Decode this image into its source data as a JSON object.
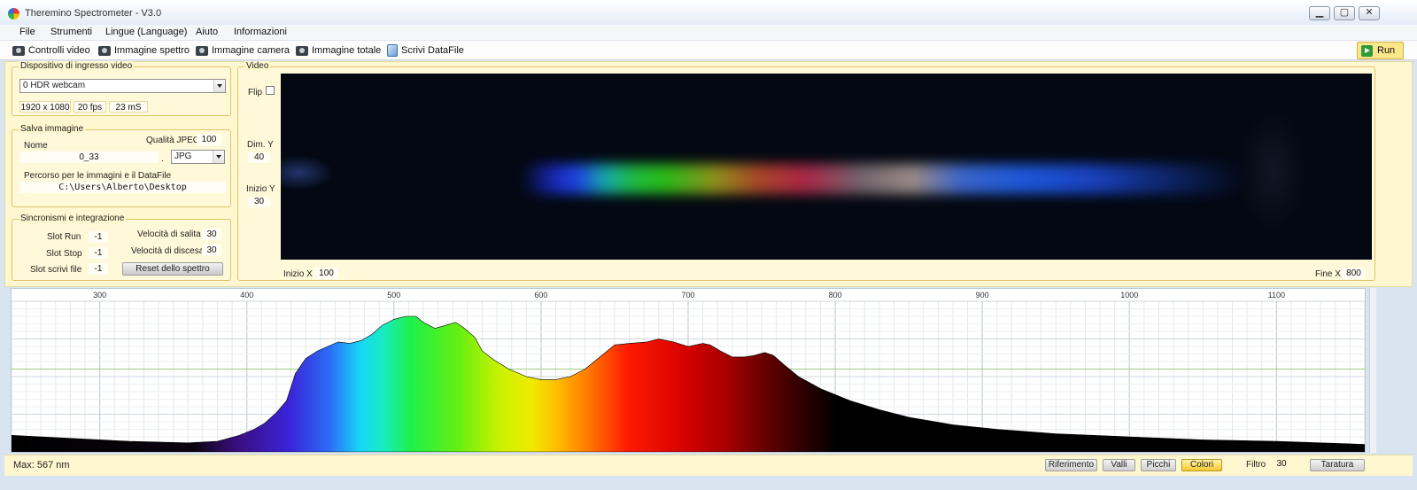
{
  "window": {
    "title": "Theremino Spectrometer - V3.0",
    "min_glyph": "▁",
    "max_glyph": "▢",
    "close_glyph": "✕"
  },
  "menu": [
    "File",
    "Strumenti",
    "Lingue (Language)",
    "Aiuto",
    "Informazioni"
  ],
  "toolbar": {
    "items": [
      "Controlli video",
      "Immagine spettro",
      "Immagine camera",
      "Immagine totale",
      "Scrivi DataFile"
    ],
    "run_label": "Run"
  },
  "device": {
    "title": "Dispositivo di ingresso video",
    "selected": "0 HDR webcam",
    "resolution": "1920 x 1080",
    "fps": "20 fps",
    "ms": "23 mS"
  },
  "save_image": {
    "title": "Salva immagine",
    "name_label": "Nome",
    "quality_label": "Qualità JPEG",
    "quality_value": "100",
    "name_value": "0_33",
    "dot": ".",
    "format_selected": "JPG",
    "path_label": "Percorso per le immagini e il DataFile",
    "path_value": "C:\\Users\\Alberto\\Desktop"
  },
  "sync": {
    "title": "Sincronismi e integrazione",
    "slot_run_label": "Slot Run",
    "slot_run_value": "-1",
    "slot_stop_label": "Slot Stop",
    "slot_stop_value": "-1",
    "slot_write_label": "Slot scrivi file",
    "slot_write_value": "-1",
    "rise_label": "Velocità di salita",
    "rise_value": "30",
    "fall_label": "Velocità di discesa",
    "fall_value": "30",
    "reset_label": "Reset dello spettro"
  },
  "video": {
    "title": "Video",
    "flip_label": "Flip",
    "dim_y_label": "Dim. Y",
    "dim_y_value": "40",
    "start_y_label": "Inizio Y",
    "start_y_value": "30",
    "start_x_label": "Inizio X",
    "start_x_value": "100",
    "end_x_label": "Fine X",
    "end_x_value": "800"
  },
  "graph": {
    "x_ticks": [
      300,
      400,
      500,
      600,
      700,
      800,
      900,
      1000,
      1100
    ],
    "x_range": [
      240,
      1160
    ],
    "y_range": [
      0,
      100
    ],
    "reference_level": 55,
    "profile": [
      [
        240,
        11
      ],
      [
        280,
        9
      ],
      [
        320,
        7
      ],
      [
        360,
        6
      ],
      [
        380,
        7
      ],
      [
        395,
        11
      ],
      [
        405,
        15
      ],
      [
        412,
        19
      ],
      [
        420,
        26
      ],
      [
        427,
        34
      ],
      [
        433,
        52
      ],
      [
        440,
        62
      ],
      [
        448,
        67
      ],
      [
        455,
        70
      ],
      [
        462,
        73
      ],
      [
        470,
        72
      ],
      [
        478,
        74
      ],
      [
        485,
        78
      ],
      [
        492,
        84
      ],
      [
        500,
        88
      ],
      [
        508,
        90
      ],
      [
        515,
        90
      ],
      [
        520,
        86
      ],
      [
        528,
        82
      ],
      [
        535,
        84
      ],
      [
        542,
        86
      ],
      [
        548,
        82
      ],
      [
        555,
        76
      ],
      [
        560,
        67
      ],
      [
        568,
        61
      ],
      [
        578,
        55
      ],
      [
        590,
        50
      ],
      [
        600,
        48
      ],
      [
        610,
        48
      ],
      [
        620,
        50
      ],
      [
        630,
        55
      ],
      [
        640,
        63
      ],
      [
        650,
        71
      ],
      [
        660,
        72
      ],
      [
        672,
        73
      ],
      [
        680,
        75
      ],
      [
        690,
        73
      ],
      [
        700,
        70
      ],
      [
        710,
        72
      ],
      [
        715,
        71
      ],
      [
        722,
        67
      ],
      [
        730,
        63
      ],
      [
        738,
        63
      ],
      [
        745,
        64
      ],
      [
        752,
        66
      ],
      [
        758,
        64
      ],
      [
        765,
        58
      ],
      [
        775,
        50
      ],
      [
        790,
        42
      ],
      [
        810,
        34
      ],
      [
        830,
        28
      ],
      [
        850,
        23
      ],
      [
        880,
        18
      ],
      [
        910,
        15
      ],
      [
        950,
        12
      ],
      [
        1000,
        10
      ],
      [
        1050,
        8
      ],
      [
        1100,
        7
      ],
      [
        1160,
        5
      ]
    ]
  },
  "status": {
    "max_text": "Max: 567 nm",
    "buttons": [
      "Riferimento",
      "Valli",
      "Picchi",
      "Colori"
    ],
    "active_button": "Colori",
    "filter_label": "Filtro",
    "filter_value": "30",
    "calibration_label": "Taratura"
  }
}
